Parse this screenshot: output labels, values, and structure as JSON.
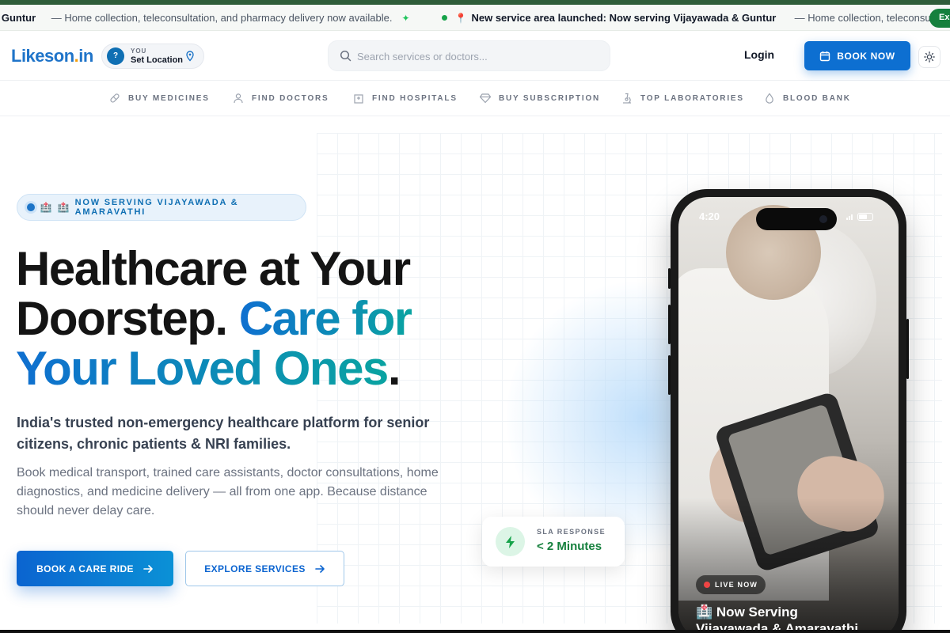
{
  "ticker": {
    "items": [
      {
        "strong": "a & Guntur",
        "text": "— Home collection, teleconsultation, and pharmacy delivery now available."
      },
      {
        "strong": "New service area launched: Now serving Vijayawada & Guntur",
        "text": "— Home collection, teleconsultation,"
      }
    ],
    "pill": "Ex"
  },
  "header": {
    "logo": {
      "part1": "Likeson",
      "part2": ".",
      "part3": "in"
    },
    "location": {
      "icon_text": "?",
      "you": "YOU",
      "label": "Set Location"
    },
    "search": {
      "placeholder": "Search services or doctors..."
    },
    "login": "Login",
    "book_now": "BOOK NOW"
  },
  "nav": {
    "items": [
      {
        "label": "BUY MEDICINES",
        "icon": "pill-icon"
      },
      {
        "label": "FIND DOCTORS",
        "icon": "user-icon"
      },
      {
        "label": "FIND HOSPITALS",
        "icon": "hospital-icon"
      },
      {
        "label": "BUY SUBSCRIPTION",
        "icon": "diamond-icon"
      },
      {
        "label": "TOP LABORATORIES",
        "icon": "microscope-icon"
      },
      {
        "label": "BLOOD BANK",
        "icon": "droplet-icon"
      }
    ]
  },
  "hero": {
    "badge": "NOW SERVING VIJAYAWADA & AMARAVATHI",
    "headline_line1": "Healthcare at Your",
    "headline_line2": "Doorstep.",
    "headline_highlight_a": "Care for",
    "headline_highlight_b": "Your Loved Ones",
    "headline_end": ".",
    "lead": "India's trusted non-emergency healthcare platform for senior citizens, chronic patients & NRI families.",
    "body": "Book medical transport, trained care assistants, doctor consultations, home diagnostics, and medicine delivery — all from one app. Because distance should never delay care.",
    "cta_primary": "BOOK A CARE RIDE",
    "cta_secondary": "EXPLORE SERVICES",
    "sla": {
      "label": "SLA RESPONSE",
      "value": "< 2 Minutes"
    }
  },
  "phone": {
    "time": "4:20",
    "live": "LIVE NOW",
    "caption_line1": "Now Serving",
    "caption_line2": "Vijayawada & Amaravathi"
  },
  "colors": {
    "brand_blue": "#0d6fd1",
    "accent_teal": "#0aa3a1",
    "logo_orange": "#f59e0b",
    "success_green": "#15803d"
  }
}
